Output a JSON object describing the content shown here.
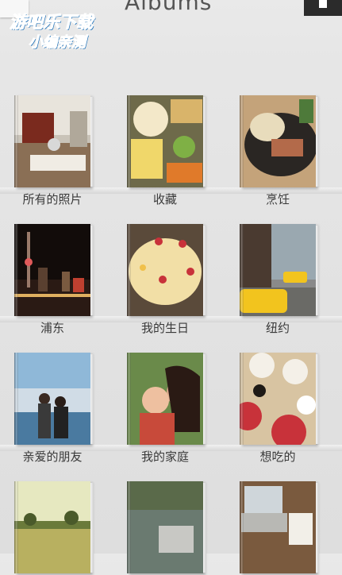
{
  "header": {
    "title": "Albums"
  },
  "watermark": {
    "line1": "游吧乐下载",
    "line2": "小编亲测"
  },
  "albums": [
    {
      "label": "所有的照片"
    },
    {
      "label": "收藏"
    },
    {
      "label": "烹饪"
    },
    {
      "label": "浦东"
    },
    {
      "label": "我的生日"
    },
    {
      "label": "纽约"
    },
    {
      "label": "亲爱的朋友"
    },
    {
      "label": "我的家庭"
    },
    {
      "label": "想吃的"
    },
    {
      "label": ""
    },
    {
      "label": ""
    },
    {
      "label": ""
    }
  ]
}
